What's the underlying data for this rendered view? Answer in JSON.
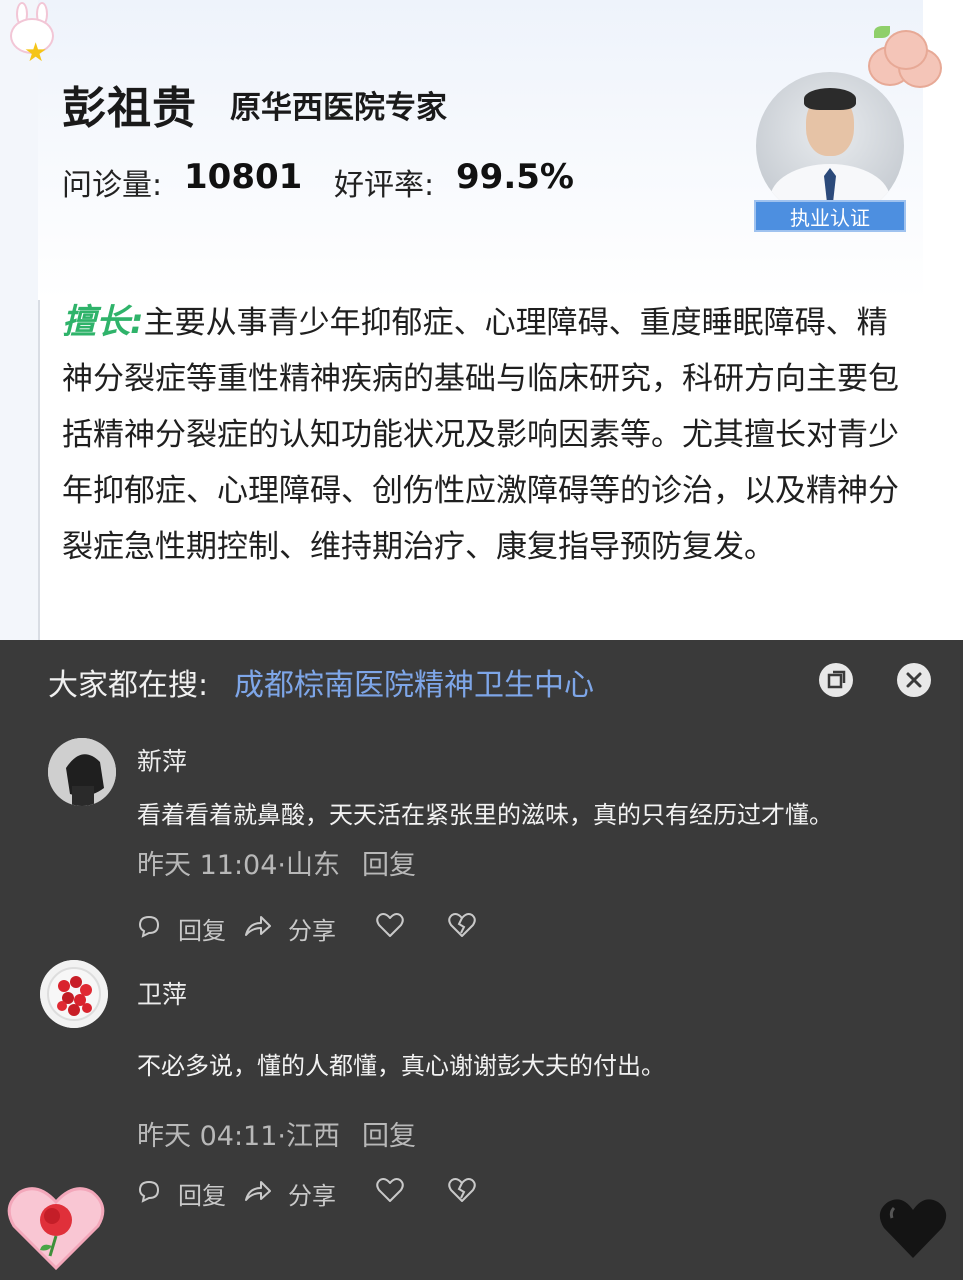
{
  "doctor": {
    "name": "彭祖贵",
    "title": "原华西医院专家",
    "consult_label": "问诊量:",
    "consult_value": "10801",
    "rating_label": "好评率:",
    "rating_value": "99.5%",
    "badge": "执业认证",
    "specialty_tag": "擅长:",
    "specialty_text": "主要从事青少年抑郁症、心理障碍、重度睡眠障碍、精神分裂症等重性精神疾病的基础与临床研究，科研方向主要包括精神分裂症的认知功能状况及影响因素等。尤其擅长对青少年抑郁症、心理障碍、创伤性应激障碍等的诊治，以及精神分裂症急性期控制、维持期治疗、康复指导预防复发。"
  },
  "search": {
    "label": "大家都在搜:",
    "link": "成都棕南医院精神卫生中心"
  },
  "comments": [
    {
      "name": "新萍",
      "text": "看着看着就鼻酸，天天活在紧张里的滋味，真的只有经历过才懂。",
      "time_location": "昨天 11:04·山东",
      "reply_label": "回复",
      "actions": {
        "reply": "回复",
        "share": "分享"
      }
    },
    {
      "name": "卫萍",
      "text": "不必多说，懂的人都懂，真心谢谢彭大夫的付出。",
      "time_location": "昨天 04:11·江西",
      "reply_label": "回复",
      "actions": {
        "reply": "回复",
        "share": "分享"
      }
    }
  ],
  "icons": {
    "restore": "restore-icon",
    "close": "close-icon",
    "comment": "comment-icon",
    "share": "share-icon",
    "like": "heart-icon",
    "dislike": "broken-heart-icon"
  },
  "colors": {
    "panel_bg": "#3a3a3a",
    "link": "#7ea6e8",
    "specialty_tag": "#2fb36a",
    "badge": "#4d8fe0"
  }
}
